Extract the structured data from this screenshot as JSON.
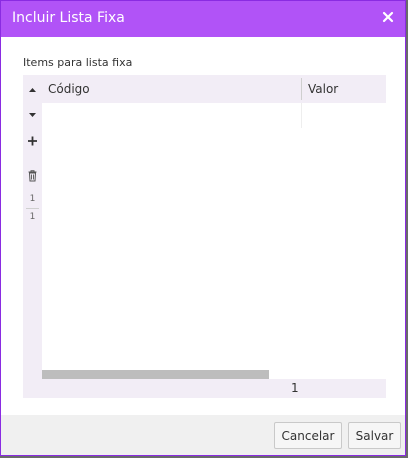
{
  "dialog": {
    "title": "Incluir Lista Fixa",
    "close_icon": "close-icon"
  },
  "list": {
    "label": "Items para lista fixa",
    "toolbar": {
      "move_up_icon": "triangle-up-icon",
      "move_down_icon": "triangle-down-icon",
      "add_icon": "plus-icon",
      "delete_icon": "trash-icon"
    },
    "row_numbers": [
      "1",
      "1"
    ],
    "columns": [
      "Código",
      "Valor"
    ],
    "rows": [],
    "footer": {
      "page": "1"
    }
  },
  "buttons": {
    "cancel": "Cancelar",
    "save": "Salvar"
  },
  "colors": {
    "titlebar": "#b153f7",
    "grid_background": "#f2edf6"
  }
}
